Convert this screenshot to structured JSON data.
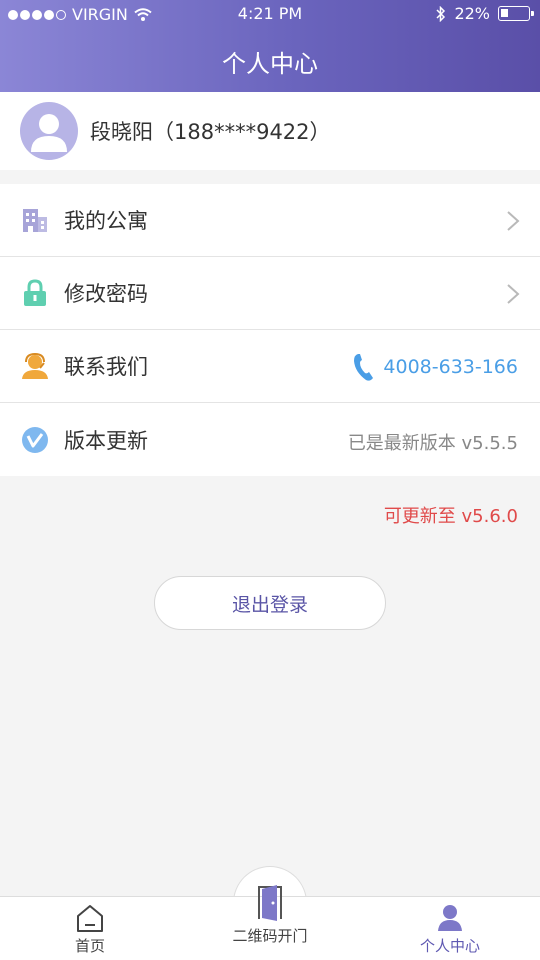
{
  "status": {
    "carrier": "VIRGIN",
    "time": "4:21 PM",
    "battery": "22%"
  },
  "header": {
    "title": "个人中心"
  },
  "profile": {
    "name": "段晓阳（188****9422）"
  },
  "menu": [
    {
      "label": "我的公寓",
      "icon": "building-icon"
    },
    {
      "label": "修改密码",
      "icon": "lock-icon"
    },
    {
      "label": "联系我们",
      "icon": "customer-service-icon",
      "phone": "4008-633-166"
    },
    {
      "label": "版本更新",
      "icon": "version-icon",
      "value": "已是最新版本 v5.5.5"
    }
  ],
  "update_notice": "可更新至 v5.6.0",
  "logout_label": "退出登录",
  "tabs": [
    {
      "label": "首页",
      "icon": "home-icon"
    },
    {
      "label": "二维码开门",
      "icon": "door-icon"
    },
    {
      "label": "个人中心",
      "icon": "person-icon",
      "active": true
    }
  ],
  "colors": {
    "header_start": "#8b86d6",
    "header_end": "#5a4fa8",
    "accent": "#5f59b2",
    "phone": "#4a9ee6",
    "alert": "#e04a4a"
  }
}
